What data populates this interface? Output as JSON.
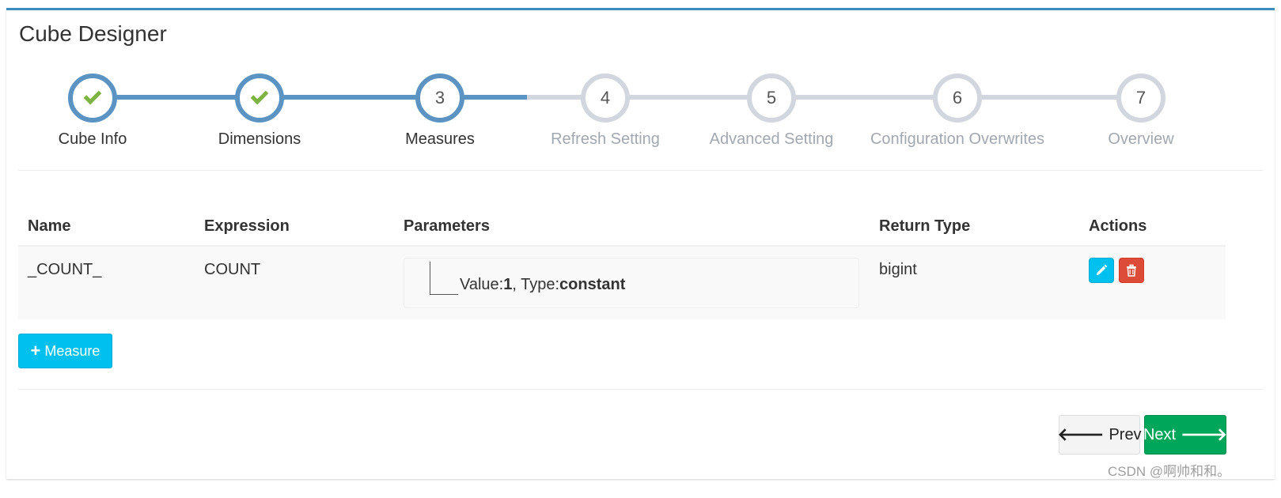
{
  "header": {
    "title": "Cube Designer"
  },
  "wizard": {
    "steps": [
      {
        "number": "",
        "label": "Cube Info",
        "state": "done"
      },
      {
        "number": "",
        "label": "Dimensions",
        "state": "done"
      },
      {
        "number": "3",
        "label": "Measures",
        "state": "active"
      },
      {
        "number": "4",
        "label": "Refresh Setting",
        "state": "todo"
      },
      {
        "number": "5",
        "label": "Advanced Setting",
        "state": "todo"
      },
      {
        "number": "6",
        "label": "Configuration Overwrites",
        "state": "todo"
      },
      {
        "number": "7",
        "label": "Overview",
        "state": "todo"
      }
    ]
  },
  "table": {
    "columns": [
      "Name",
      "Expression",
      "Parameters",
      "Return Type",
      "Actions"
    ],
    "rows": [
      {
        "name": "_COUNT_",
        "expression": "COUNT",
        "param_value_label": "Value:",
        "param_value": "1",
        "param_type_label": ", Type:",
        "param_type": "constant",
        "return_type": "bigint"
      }
    ]
  },
  "actions": {
    "add_measure": "Measure",
    "prev": "Prev",
    "next": "Next"
  },
  "colors": {
    "accent": "#3c8dbc",
    "step_done": "#5b94c3",
    "check": "#7cb342",
    "info": "#00c0ef",
    "danger": "#dd4b39",
    "success": "#00a65a"
  },
  "watermark": "CSDN @啊帅和和。"
}
